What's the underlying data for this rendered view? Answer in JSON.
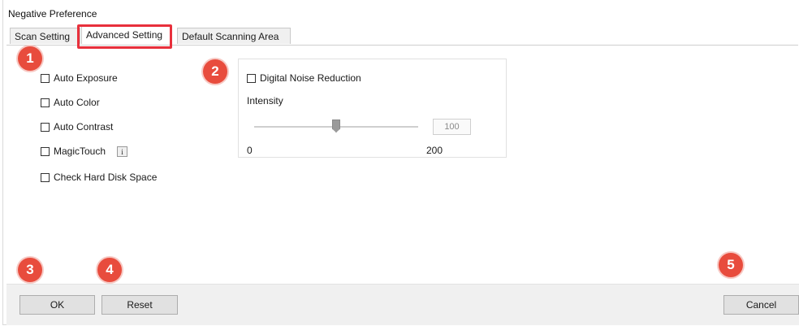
{
  "window": {
    "title": "Negative Preference"
  },
  "tabs": [
    {
      "label": "Scan Setting",
      "active": false
    },
    {
      "label": "Advanced Setting",
      "active": true
    },
    {
      "label": "Default Scanning Area",
      "active": false
    }
  ],
  "options": [
    {
      "label": "Auto Exposure",
      "checked": false
    },
    {
      "label": "Auto Color",
      "checked": false
    },
    {
      "label": "Auto Contrast",
      "checked": false
    },
    {
      "label": "MagicTouch",
      "checked": false
    },
    {
      "label": "Check Hard Disk Space",
      "checked": false
    }
  ],
  "info_button": {
    "label": "i",
    "icon": "info-icon"
  },
  "noise_reduction": {
    "label": "Digital Noise Reduction",
    "checked": false,
    "intensity_label": "Intensity",
    "value": "100",
    "min_label": "0",
    "max_label": "200"
  },
  "buttons": {
    "ok": "OK",
    "reset": "Reset",
    "cancel": "Cancel"
  },
  "badges": [
    "1",
    "2",
    "3",
    "4",
    "5"
  ],
  "colors": {
    "badge": "#e84c3d",
    "highlight": "#e8303c"
  }
}
